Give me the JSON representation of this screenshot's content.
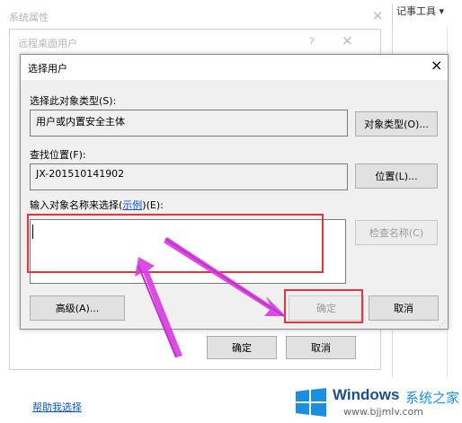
{
  "background": {
    "sysprop_title": "系统属性",
    "sysprop_close": "×",
    "top_right_fragment": "记事工具 ▾",
    "remote_title": "远程桌面用户",
    "remote_help": "?",
    "remote_close": "×",
    "ok_label": "确定",
    "cancel_label": "取消",
    "help_link": "帮助我选择"
  },
  "dialog": {
    "title": "选择用户",
    "close": "×",
    "object_type_label": "选择此对象类型(S):",
    "object_type_value": "用户或内置安全主体",
    "object_type_button": "对象类型(O)...",
    "location_label": "查找位置(F):",
    "location_value": "JX-201510141902",
    "location_button": "位置(L)...",
    "enter_names_label_prefix": "输入对象名称来选择(",
    "enter_names_link": "示例",
    "enter_names_label_suffix": ")(E):",
    "names_input_value": "",
    "check_names_button": "检查名称(C)",
    "advanced_button": "高级(A)...",
    "ok_button": "确定",
    "cancel_button": "取消"
  },
  "watermark": {
    "brand": "Windows",
    "site_cn": "系统之家",
    "url": "www.bjjmlv.com"
  },
  "colors": {
    "highlight_box": "#e8333a",
    "arrow": "#d83ee0",
    "link": "#0b57d0",
    "win_logo": "#1b8fe0"
  }
}
